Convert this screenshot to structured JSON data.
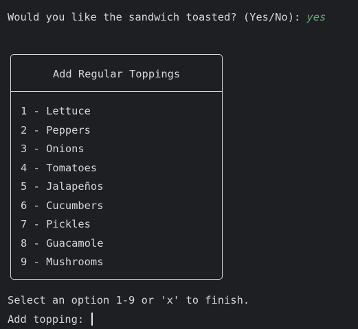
{
  "terminal": {
    "toast_question": "Would you like the sandwich toasted? (Yes/No): ",
    "toast_answer": "yes",
    "menu": {
      "title": "Add Regular Toppings",
      "items": [
        "1 - Lettuce",
        "2 - Peppers",
        "3 - Onions",
        "4 - Tomatoes",
        "5 - Jalapeños",
        "6 - Cucumbers",
        "7 - Pickles",
        "8 - Guacamole",
        "9 - Mushrooms"
      ]
    },
    "instruction": "Select an option 1-9 or 'x' to finish.",
    "input_prompt": "Add topping: "
  },
  "colors": {
    "background": "#1e1f22",
    "text": "#d4d7dd",
    "user_input": "#6aab73"
  }
}
